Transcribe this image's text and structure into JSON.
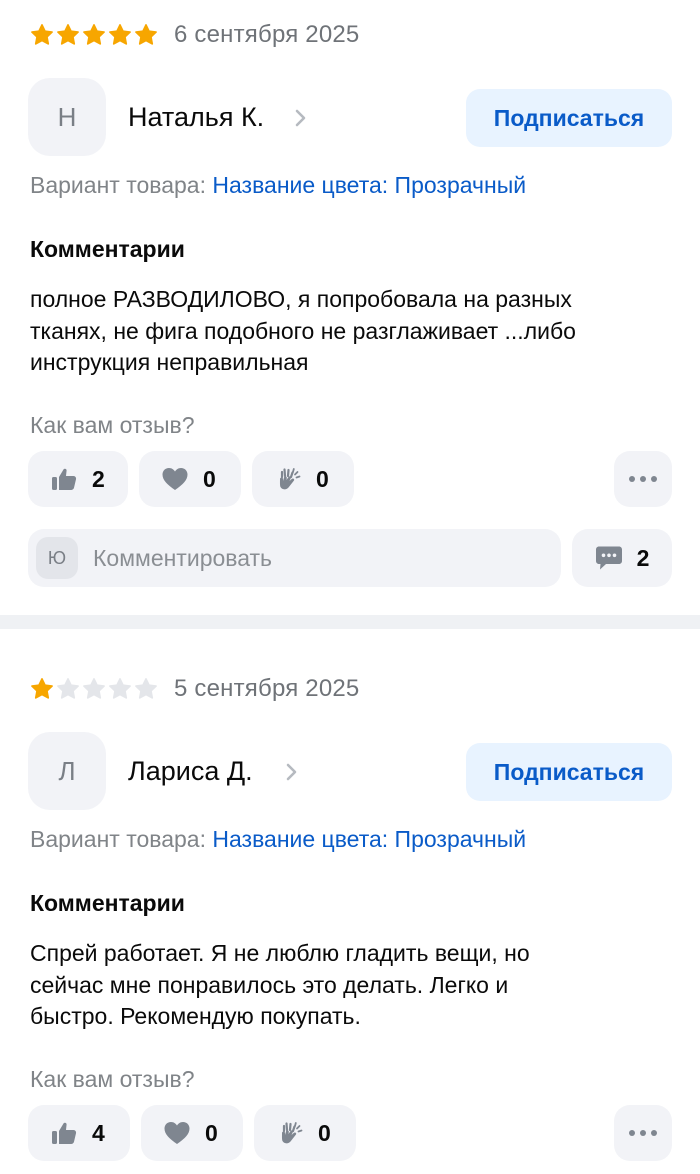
{
  "colors": {
    "star_filled": "#f7a600",
    "star_empty": "#e4e6ea",
    "accent": "#0a5bc8",
    "chip_bg": "#f2f3f7",
    "subscribe_bg": "#e8f3ff",
    "icon_gray": "#7f8690"
  },
  "reviews": [
    {
      "rating": 5,
      "rating_max": 5,
      "date": "6 сентября 2025",
      "author": {
        "initial": "Н",
        "name": "Наталья К."
      },
      "subscribe_label": "Подписаться",
      "variant_label": "Вариант товара:",
      "variant_value": "Название цвета: Прозрачный",
      "comment_title": "Комментарии",
      "comment_lines": [
        "полное РАЗВОДИЛОВО, я попробовала на разных",
        "тканях, не фига подобного не разглаживает ...либо",
        "инструкция неправильная"
      ],
      "feedback_question": "Как вам отзыв?",
      "reactions": {
        "like": "2",
        "heart": "0",
        "clap": "0"
      },
      "comment_avatar": "Ю",
      "comment_placeholder": "Комментировать",
      "comments_count": "2"
    },
    {
      "rating": 1,
      "rating_max": 5,
      "date": "5 сентября 2025",
      "author": {
        "initial": "Л",
        "name": "Лариса Д."
      },
      "subscribe_label": "Подписаться",
      "variant_label": "Вариант товара:",
      "variant_value": "Название цвета: Прозрачный",
      "comment_title": "Комментарии",
      "comment_lines": [
        "Спрей работает. Я не люблю гладить вещи, но",
        "сейчас мне понравилось это делать. Легко и",
        "быстро. Рекомендую покупать."
      ],
      "feedback_question": "Как вам отзыв?",
      "reactions": {
        "like": "4",
        "heart": "0",
        "clap": "0"
      }
    }
  ]
}
